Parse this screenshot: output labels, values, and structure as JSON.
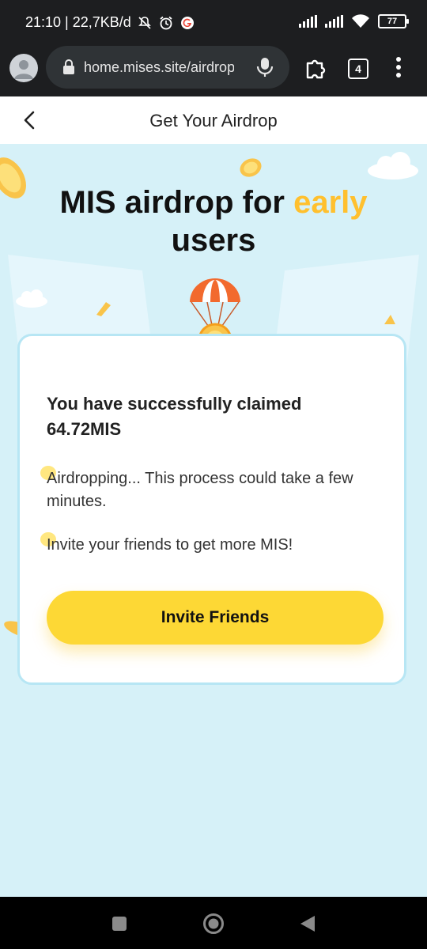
{
  "status_bar": {
    "time_speed": "21:10 | 22,7KB/d",
    "battery": "77"
  },
  "browser": {
    "url": "home.mises.site/airdrop",
    "tab_count": "4"
  },
  "header": {
    "title": "Get Your Airdrop"
  },
  "hero": {
    "title_part1": "MIS airdrop for ",
    "title_accent": "early",
    "title_part2": "users"
  },
  "card": {
    "claimed": "You have successfully claimed 64.72MIS",
    "airdropping": "Airdropping... This process could take a few minutes.",
    "invite_info": "Invite your friends to get more MIS!",
    "invite_button": "Invite Friends"
  },
  "colors": {
    "accent_yellow": "#fdd835",
    "accent_orange": "#ffc02e",
    "background": "#d6f1f8"
  }
}
